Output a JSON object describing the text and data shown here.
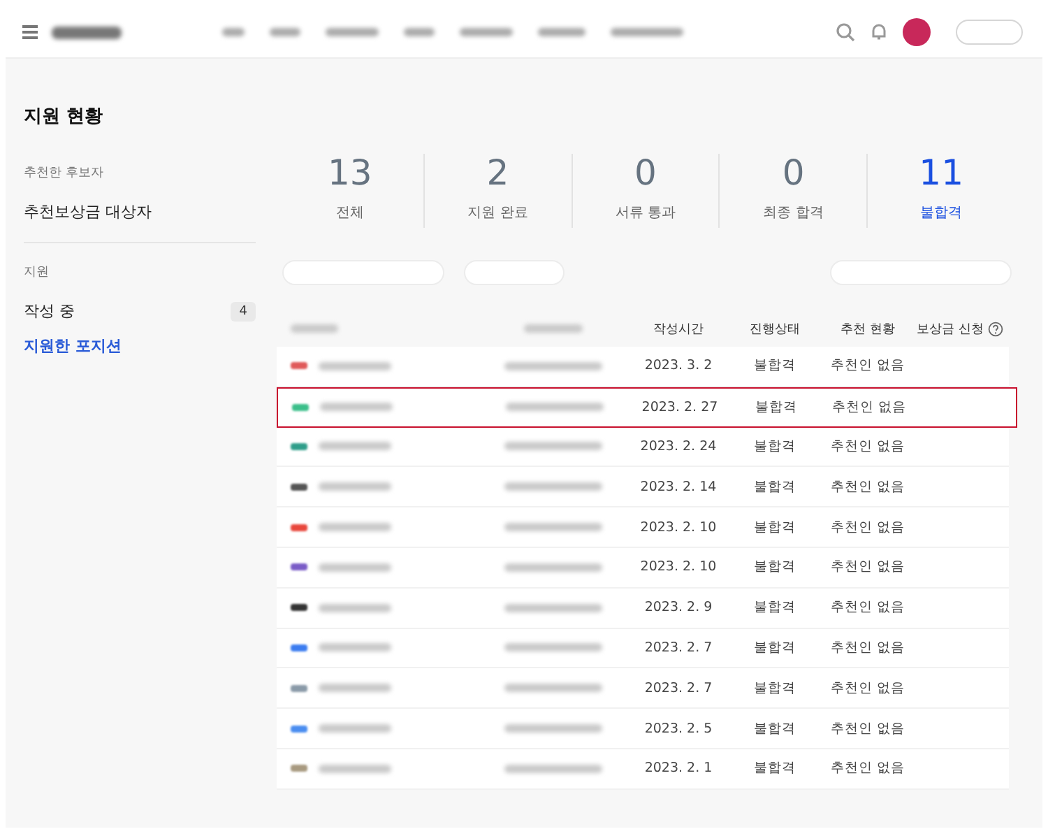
{
  "sidebar": {
    "title": "지원 현황",
    "sections": [
      {
        "heading": "추천한 후보자",
        "items": [
          {
            "label": "추천보상금 대상자",
            "selected": false
          }
        ]
      },
      {
        "heading": "지원",
        "items": [
          {
            "label": "작성 중",
            "count": "4",
            "selected": false
          },
          {
            "label": "지원한 포지션",
            "selected": true
          }
        ]
      }
    ]
  },
  "stats": [
    {
      "value": "13",
      "label": "전체",
      "selected": false
    },
    {
      "value": "2",
      "label": "지원 완료",
      "selected": false
    },
    {
      "value": "0",
      "label": "서류 통과",
      "selected": false
    },
    {
      "value": "0",
      "label": "최종 합격",
      "selected": false
    },
    {
      "value": "11",
      "label": "불합격",
      "selected": true
    }
  ],
  "table": {
    "columns": [
      "작성시간",
      "진행상태",
      "추천 현황",
      "보상금 신청"
    ],
    "rows": [
      {
        "color": "#e05a5a",
        "date": "2023. 3. 2",
        "status": "불합격",
        "recommendation": "추천인 없음",
        "highlighted": false
      },
      {
        "color": "#3bbf8a",
        "date": "2023. 2. 27",
        "status": "불합격",
        "recommendation": "추천인 없음",
        "highlighted": true
      },
      {
        "color": "#2f9e8a",
        "date": "2023. 2. 24",
        "status": "불합격",
        "recommendation": "추천인 없음",
        "highlighted": false
      },
      {
        "color": "#555555",
        "date": "2023. 2. 14",
        "status": "불합격",
        "recommendation": "추천인 없음",
        "highlighted": false
      },
      {
        "color": "#e8473c",
        "date": "2023. 2. 10",
        "status": "불합격",
        "recommendation": "추천인 없음",
        "highlighted": false
      },
      {
        "color": "#7a5cc7",
        "date": "2023. 2. 10",
        "status": "불합격",
        "recommendation": "추천인 없음",
        "highlighted": false
      },
      {
        "color": "#333333",
        "date": "2023. 2. 9",
        "status": "불합격",
        "recommendation": "추천인 없음",
        "highlighted": false
      },
      {
        "color": "#3b7cf0",
        "date": "2023. 2. 7",
        "status": "불합격",
        "recommendation": "추천인 없음",
        "highlighted": false
      },
      {
        "color": "#8a9aa8",
        "date": "2023. 2. 7",
        "status": "불합격",
        "recommendation": "추천인 없음",
        "highlighted": false
      },
      {
        "color": "#4a8df0",
        "date": "2023. 2. 5",
        "status": "불합격",
        "recommendation": "추천인 없음",
        "highlighted": false
      },
      {
        "color": "#a89a80",
        "date": "2023. 2. 1",
        "status": "불합격",
        "recommendation": "추천인 없음",
        "highlighted": false
      }
    ]
  }
}
